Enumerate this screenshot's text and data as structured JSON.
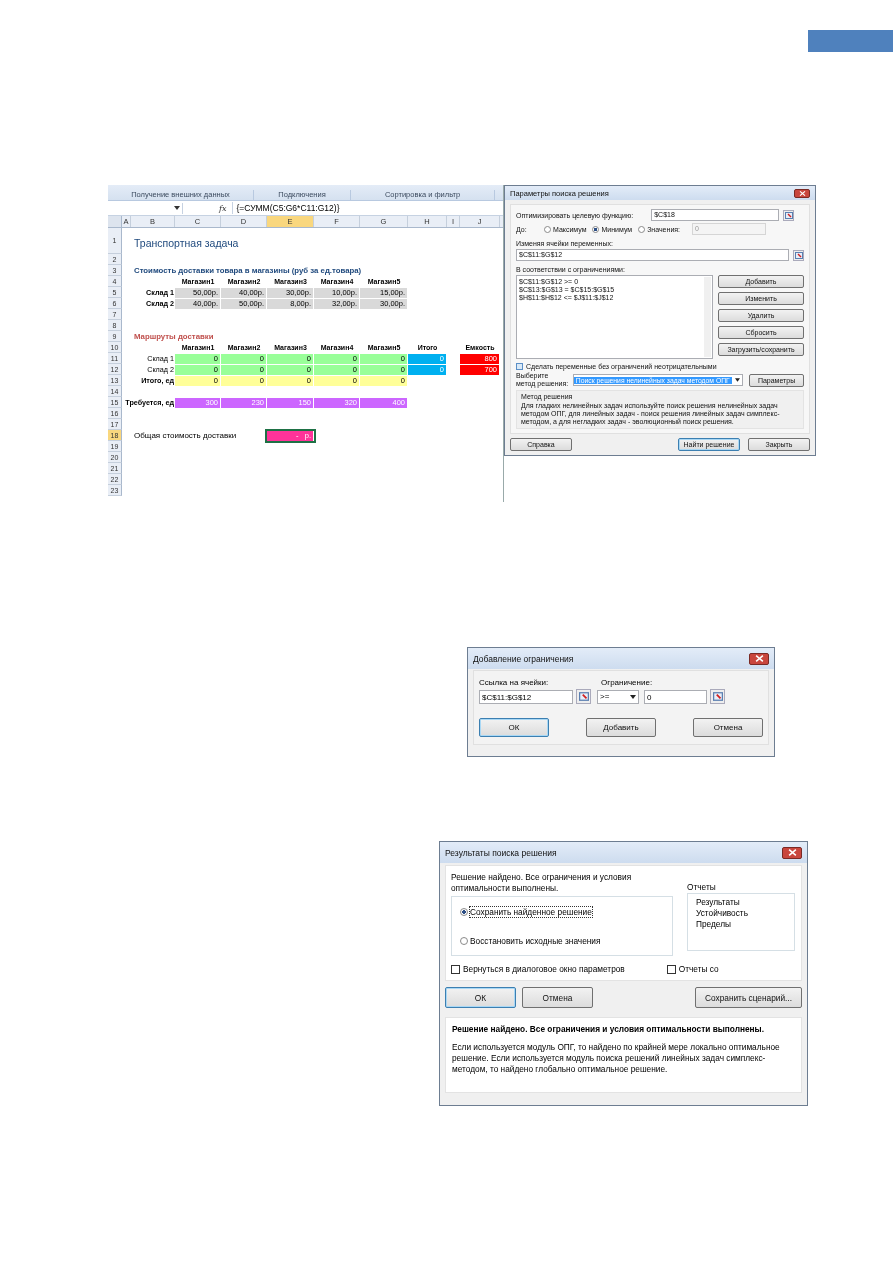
{
  "excel": {
    "ribbon_groups": [
      "Получение внешних данных",
      "Подключения",
      "Сортировка и фильтр"
    ],
    "fx": "fx",
    "formula": "{=СУММ(C5:G6*C11:G12)}",
    "columns": [
      {
        "label": "A",
        "selected": false
      },
      {
        "label": "B",
        "selected": false
      },
      {
        "label": "C",
        "selected": false
      },
      {
        "label": "D",
        "selected": false
      },
      {
        "label": "E",
        "selected": true
      },
      {
        "label": "F",
        "selected": false
      },
      {
        "label": "G",
        "selected": false
      },
      {
        "label": "H",
        "selected": false
      },
      {
        "label": "I",
        "selected": false
      },
      {
        "label": "J",
        "selected": false
      }
    ],
    "rows": [
      {
        "num": "1",
        "selected": false,
        "cells": {
          "B": {
            "kind": "title",
            "text": "Транспортная задача"
          }
        }
      },
      {
        "num": "2",
        "selected": false
      },
      {
        "num": "3",
        "selected": false,
        "cells": {
          "B": {
            "kind": "section",
            "text": "Стоимость доставки товара в магазины (руб за ед.товара)",
            "color": "#1f497d"
          }
        }
      },
      {
        "num": "4",
        "selected": false,
        "cells": {
          "C": {
            "kind": "colhead",
            "text": "Магазин1"
          },
          "D": {
            "kind": "colhead",
            "text": "Магазин2"
          },
          "E": {
            "kind": "colhead",
            "text": "Магазин3"
          },
          "F": {
            "kind": "colhead",
            "text": "Магазин4"
          },
          "G": {
            "kind": "colhead",
            "text": "Магазин5"
          }
        }
      },
      {
        "num": "5",
        "selected": false,
        "cells": {
          "B": {
            "kind": "rowhead",
            "text": "Склад 1",
            "bold": true
          },
          "C": {
            "kind": "value",
            "text": "50,00р.",
            "color": "#d9d9d9"
          },
          "D": {
            "kind": "value",
            "text": "40,00р.",
            "color": "#d9d9d9"
          },
          "E": {
            "kind": "value",
            "text": "30,00р.",
            "color": "#d9d9d9"
          },
          "F": {
            "kind": "value",
            "text": "10,00р.",
            "color": "#d9d9d9"
          },
          "G": {
            "kind": "value",
            "text": "15,00р.",
            "color": "#d9d9d9"
          }
        }
      },
      {
        "num": "6",
        "selected": false,
        "cells": {
          "B": {
            "kind": "rowhead",
            "text": "Склад 2",
            "bold": true
          },
          "C": {
            "kind": "value",
            "text": "40,00р.",
            "color": "#d9d9d9"
          },
          "D": {
            "kind": "value",
            "text": "50,00р.",
            "color": "#d9d9d9"
          },
          "E": {
            "kind": "value",
            "text": "8,00р.",
            "color": "#d9d9d9"
          },
          "F": {
            "kind": "value",
            "text": "32,00р.",
            "color": "#d9d9d9"
          },
          "G": {
            "kind": "value",
            "text": "30,00р.",
            "color": "#d9d9d9"
          }
        }
      },
      {
        "num": "7",
        "selected": false
      },
      {
        "num": "8",
        "selected": false
      },
      {
        "num": "9",
        "selected": false,
        "cells": {
          "B": {
            "kind": "section",
            "text": "Маршруты доставки",
            "color": "#c0504d"
          }
        }
      },
      {
        "num": "10",
        "selected": false,
        "cells": {
          "C": {
            "kind": "colhead",
            "text": "Магазин1"
          },
          "D": {
            "kind": "colhead",
            "text": "Магазин2"
          },
          "E": {
            "kind": "colhead",
            "text": "Магазин3"
          },
          "F": {
            "kind": "colhead",
            "text": "Магазин4"
          },
          "G": {
            "kind": "colhead",
            "text": "Магазин5"
          },
          "H": {
            "kind": "colhead",
            "text": "Итого"
          },
          "J": {
            "kind": "colhead",
            "text": "Емкость"
          }
        }
      },
      {
        "num": "11",
        "selected": false,
        "cells": {
          "B": {
            "kind": "rowhead",
            "text": "Склад 1",
            "bold": false
          },
          "C": {
            "kind": "value",
            "text": "0",
            "color": "#99ff99"
          },
          "D": {
            "kind": "value",
            "text": "0",
            "color": "#99ff99"
          },
          "E": {
            "kind": "value",
            "text": "0",
            "color": "#99ff99"
          },
          "F": {
            "kind": "value",
            "text": "0",
            "color": "#99ff99"
          },
          "G": {
            "kind": "value",
            "text": "0",
            "color": "#99ff99"
          },
          "H": {
            "kind": "value",
            "text": "0",
            "color": "#00b0f0"
          },
          "J": {
            "kind": "value",
            "text": "800",
            "color": "#ff0000"
          }
        }
      },
      {
        "num": "12",
        "selected": false,
        "cells": {
          "B": {
            "kind": "rowhead",
            "text": "Склад 2",
            "bold": false
          },
          "C": {
            "kind": "value",
            "text": "0",
            "color": "#99ff99"
          },
          "D": {
            "kind": "value",
            "text": "0",
            "color": "#99ff99"
          },
          "E": {
            "kind": "value",
            "text": "0",
            "color": "#99ff99"
          },
          "F": {
            "kind": "value",
            "text": "0",
            "color": "#99ff99"
          },
          "G": {
            "kind": "value",
            "text": "0",
            "color": "#99ff99"
          },
          "H": {
            "kind": "value",
            "text": "0",
            "color": "#00b0f0"
          },
          "J": {
            "kind": "value",
            "text": "700",
            "color": "#ff0000"
          }
        }
      },
      {
        "num": "13",
        "selected": false,
        "cells": {
          "B": {
            "kind": "rowhead",
            "text": "Итого, ед",
            "bold": true
          },
          "C": {
            "kind": "value",
            "text": "0",
            "color": "#ffff99"
          },
          "D": {
            "kind": "value",
            "text": "0",
            "color": "#ffff99"
          },
          "E": {
            "kind": "value",
            "text": "0",
            "color": "#ffff99"
          },
          "F": {
            "kind": "value",
            "text": "0",
            "color": "#ffff99"
          },
          "G": {
            "kind": "value",
            "text": "0",
            "color": "#ffff99"
          }
        }
      },
      {
        "num": "14",
        "selected": false
      },
      {
        "num": "15",
        "selected": false,
        "cells": {
          "B": {
            "kind": "rowhead",
            "text": "Требуется, ед",
            "bold": true
          },
          "C": {
            "kind": "value",
            "text": "300",
            "color": "#cc66ff"
          },
          "D": {
            "kind": "value",
            "text": "230",
            "color": "#cc66ff"
          },
          "E": {
            "kind": "value",
            "text": "150",
            "color": "#cc66ff"
          },
          "F": {
            "kind": "value",
            "text": "320",
            "color": "#cc66ff"
          },
          "G": {
            "kind": "value",
            "text": "400",
            "color": "#cc66ff"
          }
        }
      },
      {
        "num": "16",
        "selected": false
      },
      {
        "num": "17",
        "selected": false
      },
      {
        "num": "18",
        "selected": true,
        "cells": {
          "B": {
            "kind": "text",
            "text": "Общая стоимость доставки"
          },
          "E": {
            "kind": "value",
            "text": "-   р.",
            "color": "#ff3399"
          }
        }
      },
      {
        "num": "19",
        "selected": false
      },
      {
        "num": "20",
        "selected": false
      },
      {
        "num": "21",
        "selected": false
      },
      {
        "num": "22",
        "selected": false
      },
      {
        "num": "23",
        "selected": false
      }
    ]
  },
  "solver": {
    "title": "Параметры поиска решения",
    "objective_label": "Оптимизировать целевую функцию:",
    "objective": "$C$18",
    "to_label": "До:",
    "options": [
      {
        "label": "Максимум",
        "selected": false
      },
      {
        "label": "Минимум",
        "selected": true
      },
      {
        "label": "Значения:",
        "selected": false
      }
    ],
    "value_field": {
      "value": "0",
      "disabled": true
    },
    "variables_label": "Изменяя ячейки переменных:",
    "variables": "$C$11:$G$12",
    "constraints_label": "В соответствии с ограничениями:",
    "constraints": [
      "$C$11:$G$12 >= 0",
      "$C$13:$G$13 = $C$15:$G$15",
      "$H$11:$H$12 <= $J$11:$J$12"
    ],
    "side_buttons": [
      "Добавить",
      "Изменить",
      "Удалить",
      "Сбросить",
      "Загрузить/сохранить"
    ],
    "nonneg": {
      "label": "Сделать переменные без ограничений неотрицательными",
      "checked": false
    },
    "method_label": "Выберите метод решения:",
    "method": "Поиск решения нелинейных задач методом ОПГ",
    "params_button": "Параметры",
    "group_title": "Метод решения",
    "description": "Для гладких нелинейных задач используйте поиск решения нелинейных задач методом ОПГ, для линейных задач - поиск решения линейных задач симплекс-методом, а для негладких задач - эволюционный поиск решения.",
    "bottom_buttons": [
      {
        "label": "Справка",
        "default": false
      },
      {
        "label": "Найти решение",
        "default": true
      },
      {
        "label": "Закрыть",
        "default": false
      }
    ]
  },
  "add_constraint": {
    "title": "Добавление ограничения",
    "ref_label": "Ссылка на ячейки:",
    "ref": "$C$11:$G$12",
    "operator": ">=",
    "limit_label": "Ограничение:",
    "limit": "0",
    "buttons": [
      {
        "label": "ОК",
        "default": true
      },
      {
        "label": "Добавить",
        "default": false
      },
      {
        "label": "Отмена",
        "default": false
      }
    ]
  },
  "results": {
    "title": "Результаты поиска решения",
    "message": "Решение найдено. Все ограничения и условия оптимальности выполнены.",
    "options": [
      {
        "label": "Сохранить найденное решение",
        "selected": true
      },
      {
        "label": "Восстановить исходные значения",
        "selected": false
      }
    ],
    "reports_label": "Отчеты",
    "reports": [
      "Результаты",
      "Устойчивость",
      "Пределы"
    ],
    "return_check": {
      "label": "Вернуться в диалоговое окно параметров",
      "checked": false
    },
    "reports_check": {
      "label": "Отчеты со",
      "checked": false
    },
    "buttons": [
      {
        "label": "ОК",
        "default": true
      },
      {
        "label": "Отмена",
        "default": false
      },
      {
        "label": "Сохранить сценарий...",
        "default": false
      }
    ],
    "info_title": "Решение найдено. Все ограничения и условия оптимальности выполнены.",
    "info_text": "Если используется модуль ОПГ, то найдено по крайней мере локально оптимальное решение. Если используется модуль поиска решений линейных задач симплекс-методом, то найдено глобально оптимальное решение."
  }
}
